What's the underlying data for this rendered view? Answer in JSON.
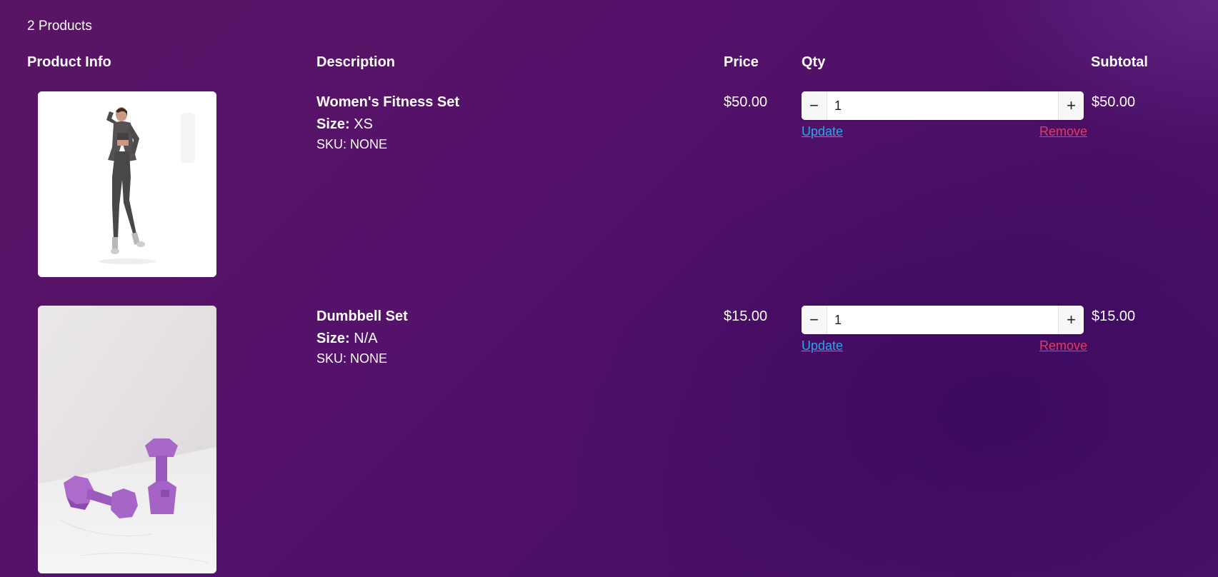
{
  "cart": {
    "count_label": "2 Products"
  },
  "columns": {
    "info": "Product Info",
    "description": "Description",
    "price": "Price",
    "qty": "Qty",
    "subtotal": "Subtotal"
  },
  "items": [
    {
      "name": "Women's Fitness Set",
      "size_label": "Size:",
      "size_value": "XS",
      "sku": "SKU: NONE",
      "price": "$50.00",
      "qty": "1",
      "subtotal": "$50.00",
      "update_label": "Update",
      "remove_label": "Remove",
      "image_icon": "woman-fitness-photo"
    },
    {
      "name": "Dumbbell Set",
      "size_label": "Size:",
      "size_value": "N/A",
      "sku": "SKU: NONE",
      "price": "$15.00",
      "qty": "1",
      "subtotal": "$15.00",
      "update_label": "Update",
      "remove_label": "Remove",
      "image_icon": "dumbbells-photo"
    }
  ],
  "qty_controls": {
    "minus_symbol": "−",
    "plus_symbol": "+"
  },
  "colors": {
    "background": "#54126a",
    "update_link": "#2ba7e8",
    "remove_link": "#e23c5f"
  }
}
